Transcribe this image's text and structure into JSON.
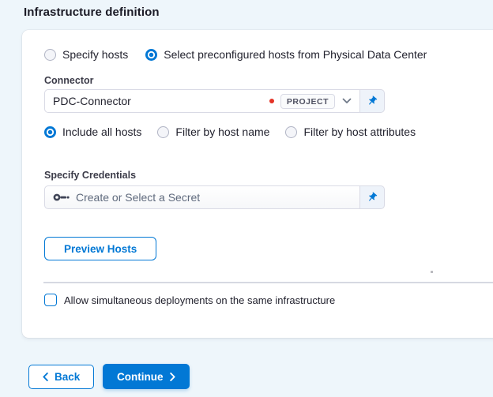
{
  "page": {
    "title": "Infrastructure definition"
  },
  "host_selection": {
    "options": [
      {
        "label": "Specify hosts",
        "selected": false
      },
      {
        "label": "Select preconfigured hosts from Physical Data Center",
        "selected": true
      }
    ]
  },
  "connector": {
    "label": "Connector",
    "value": "PDC-Connector",
    "scope_badge": "PROJECT"
  },
  "host_filter": {
    "options": [
      {
        "label": "Include all hosts",
        "selected": true
      },
      {
        "label": "Filter by host name",
        "selected": false
      },
      {
        "label": "Filter by host attributes",
        "selected": false
      }
    ]
  },
  "credentials": {
    "label": "Specify Credentials",
    "placeholder": "Create or Select a Secret"
  },
  "preview": {
    "button_label": "Preview Hosts"
  },
  "options": {
    "simultaneous_deployments": {
      "label": "Allow simultaneous deployments on the same infrastructure",
      "checked": false
    }
  },
  "footer": {
    "back_label": "Back",
    "continue_label": "Continue"
  },
  "icons": {
    "credentials_field": "key-icon",
    "runtime_input": "pin-icon",
    "connector_dropdown": "chevron-down-icon",
    "back_button": "chevron-left-icon",
    "continue_button": "chevron-right-icon"
  },
  "colors": {
    "primary": "#0278d5",
    "danger_dot": "#e43326",
    "page_background": "#eef6fb",
    "border": "#d9dae5"
  }
}
